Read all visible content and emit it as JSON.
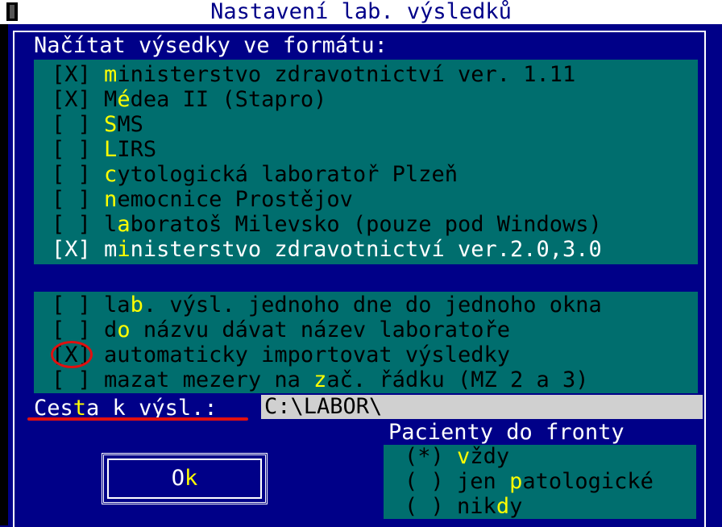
{
  "window": {
    "title": "Nastavení lab. výsledků",
    "close_icon": "close-box-icon"
  },
  "format_section": {
    "heading": "Načítat výsedky ve formátu:",
    "items": [
      {
        "box": "[X]",
        "hotkey": "m",
        "rest": "inisterstvo zdravotnictví ver. 1.11"
      },
      {
        "box": "[X]",
        "pre": "M",
        "hotkey": "é",
        "rest": "dea II (Stapro)"
      },
      {
        "box": "[ ]",
        "hotkey": "S",
        "rest": "MS"
      },
      {
        "box": "[ ]",
        "hotkey": "L",
        "rest": "IRS"
      },
      {
        "box": "[ ]",
        "hotkey": "c",
        "rest": "ytologická laboratoř Plzeň"
      },
      {
        "box": "[ ]",
        "hotkey": "n",
        "rest": "emocnice Prostějov"
      },
      {
        "box": "[ ]",
        "pre": "l",
        "hotkey": "a",
        "rest": "boratoš Milevsko (pouze pod Windows)"
      },
      {
        "box": "[X]",
        "pre": "m",
        "hotkey": "i",
        "rest": "nisterstvo zdravotnictví ver.2.0,3.0"
      }
    ]
  },
  "options_section": {
    "items": [
      {
        "box": "[ ]",
        "pre": "la",
        "hotkey": "b",
        "rest": ". výsl. jednoho dne do jednoho okna"
      },
      {
        "box": "[ ]",
        "pre": "d",
        "hotkey": "o",
        "rest": " názvu dávat název laboratoře"
      },
      {
        "box": "[X]",
        "pre": "",
        "hotkey": "",
        "rest": "automaticky importovat výsledky"
      },
      {
        "box": "[ ]",
        "pre": "mazat mezery na ",
        "hotkey": "z",
        "rest": "ač. řádku (MZ 2 a 3)"
      }
    ]
  },
  "path": {
    "label_pre": "Ces",
    "label_hotkey": "t",
    "label_rest": "a k výsl.:",
    "value": "C:\\LABOR\\"
  },
  "queue_section": {
    "title": "Pacienty do fronty",
    "items": [
      {
        "radio": "(*)",
        "pre": "",
        "hotkey": "v",
        "rest": "ždy"
      },
      {
        "radio": "( )",
        "pre": "jen ",
        "hotkey": "p",
        "rest": "atologické"
      },
      {
        "radio": "( )",
        "pre": "nik",
        "hotkey": "d",
        "rest": "y"
      }
    ]
  },
  "ok_button": {
    "pre": "O",
    "hotkey": "k"
  },
  "colors": {
    "background": "#000088",
    "group": "#006e6e",
    "hotkey": "#ffff00",
    "annotation": "#e01010"
  }
}
